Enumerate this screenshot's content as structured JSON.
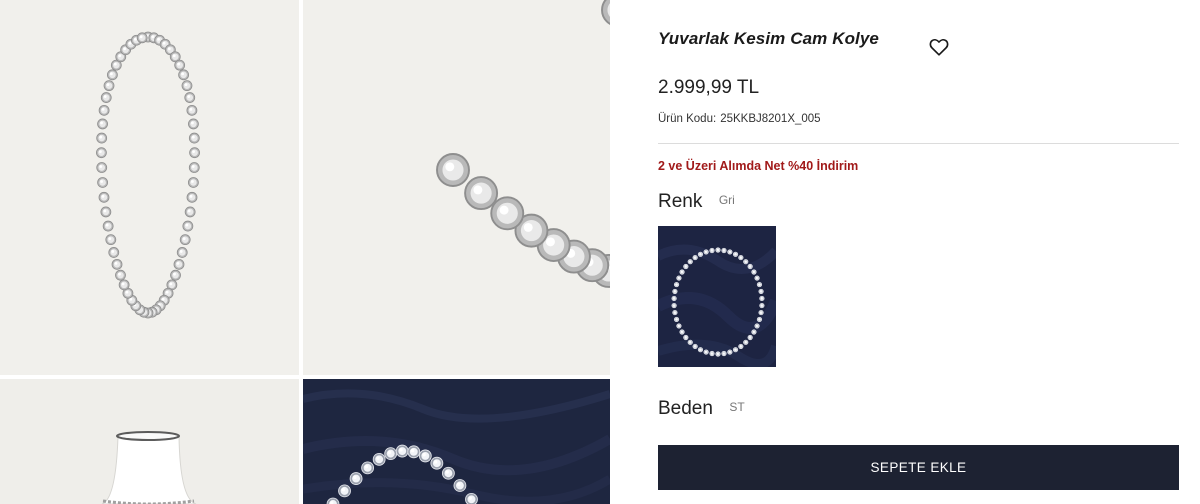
{
  "product": {
    "title": "Yuvarlak Kesim Cam Kolye",
    "price": "2.999,99 TL",
    "code_label": "Ürün Kodu:",
    "code_value": "25KKBJ8201X_005",
    "promo": "2 ve Üzeri Alımda Net %40 İndirim"
  },
  "color": {
    "label": "Renk",
    "value": "Gri"
  },
  "size": {
    "label": "Beden",
    "value": "ST"
  },
  "cart_button": {
    "label": "SEPETE EKLE"
  },
  "icons": {
    "favorite": "heart-icon"
  },
  "colors": {
    "cart_bg": "#1d2232",
    "promo": "#a11a1a",
    "gallery_bg": "#f1f0ec",
    "fabric_navy": "#1e2640"
  }
}
